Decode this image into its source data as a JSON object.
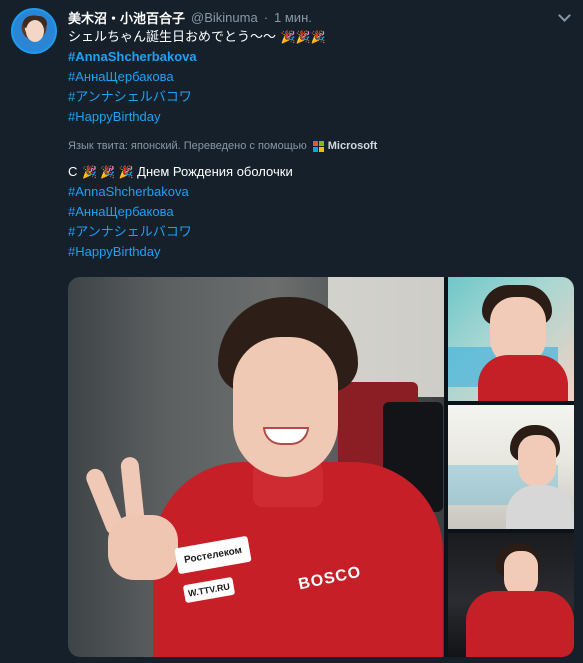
{
  "tweet": {
    "author_name": "美木沼・小池百合子",
    "handle": "@Bikinuma",
    "separator": "·",
    "time": "1 мин.",
    "original_lines": [
      {
        "text": "シェルちゃん誕生日おめでとう〜〜",
        "emoji": "🎉🎉🎉"
      },
      {
        "text": "#AnnaShcherbakova",
        "type": "hashtag",
        "bold": true
      },
      {
        "text": "#АннаЩербакова",
        "type": "hashtag"
      },
      {
        "text": "#アンナシェルバコワ",
        "type": "hashtag"
      },
      {
        "text": "#HappyBirthday",
        "type": "hashtag"
      }
    ],
    "translation_note": "Язык твита: японский. Переведено с помощью",
    "translation_brand": "Microsoft",
    "translated_lines": [
      {
        "prefix": "С",
        "emoji": "🎉 🎉 🎉",
        "text": "Днем Рождения оболочки"
      },
      {
        "text": "#AnnaShcherbakova",
        "type": "hashtag"
      },
      {
        "text": "#АннаЩербакова",
        "type": "hashtag"
      },
      {
        "text": "#アンナシェルバコワ",
        "type": "hashtag"
      },
      {
        "text": "#HappyBirthday",
        "type": "hashtag"
      }
    ],
    "media": {
      "main_patch_1": "Ростелеком",
      "main_patch_2": "W.TTV.RU",
      "main_patch_3": "BOSCO",
      "thumbnails": 3
    }
  },
  "icons": {
    "chevron": "chevron-down-icon",
    "microsoft": "microsoft-logo-icon"
  },
  "colors": {
    "background": "#15202b",
    "link": "#1da1f2",
    "secondary_text": "#8899a6",
    "jacket_red": "#c71f28"
  }
}
